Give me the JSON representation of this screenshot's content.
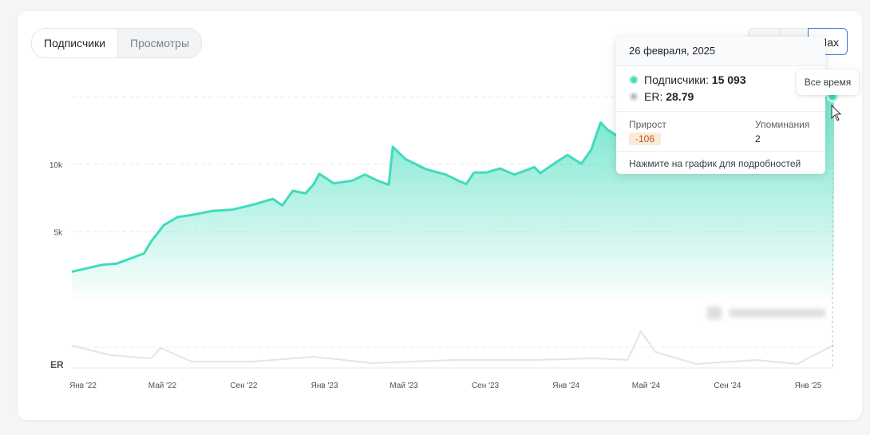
{
  "tabs": [
    {
      "label": "Подписчики",
      "active": true
    },
    {
      "label": "Просмотры",
      "active": false
    }
  ],
  "range": {
    "selected_label": "Max"
  },
  "tooltip": {
    "date": "26 февраля, 2025",
    "subscribers_label": "Подписчики:",
    "subscribers_value": "15 093",
    "er_label": "ER:",
    "er_value": "28.79",
    "growth_label": "Прирост",
    "growth_value": "-106",
    "mentions_label": "Упоминания",
    "mentions_value": "2",
    "footer": "Нажмите на график для подробностей"
  },
  "all_time_tooltip": "Все время",
  "colors": {
    "accent": "#3fdcbc",
    "er_line": "#e3e5e8",
    "selected_border": "#3a7bd5",
    "badge_bg": "#fbead9",
    "badge_text": "#c0541c"
  },
  "chart_data": {
    "type": "area",
    "series": [
      {
        "values": [
          [
            "2022-01-01",
            2050
          ],
          [
            "2022-02-15",
            2550
          ],
          [
            "2022-03-10",
            2650
          ],
          [
            "2022-04-01",
            3050
          ],
          [
            "2022-04-20",
            3400
          ],
          [
            "2022-05-01",
            4300
          ],
          [
            "2022-05-20",
            5500
          ],
          [
            "2022-06-10",
            6100
          ],
          [
            "2022-07-01",
            6250
          ],
          [
            "2022-08-01",
            6550
          ],
          [
            "2022-09-01",
            6650
          ],
          [
            "2022-10-01",
            7000
          ],
          [
            "2022-11-01",
            7450
          ],
          [
            "2022-11-15",
            6950
          ],
          [
            "2022-12-01",
            8050
          ],
          [
            "2022-12-20",
            7850
          ],
          [
            "2023-01-01",
            8500
          ],
          [
            "2023-01-10",
            9300
          ],
          [
            "2023-02-01",
            8600
          ],
          [
            "2023-03-01",
            8800
          ],
          [
            "2023-03-20",
            9250
          ],
          [
            "2023-04-10",
            8750
          ],
          [
            "2023-04-25",
            8500
          ],
          [
            "2023-05-01",
            11300
          ],
          [
            "2023-05-20",
            10400
          ],
          [
            "2023-06-20",
            9650
          ],
          [
            "2023-07-20",
            9250
          ],
          [
            "2023-08-10",
            8750
          ],
          [
            "2023-08-20",
            8550
          ],
          [
            "2023-09-01",
            9400
          ],
          [
            "2023-09-20",
            9400
          ],
          [
            "2023-10-10",
            9700
          ],
          [
            "2023-11-01",
            9250
          ],
          [
            "2023-12-01",
            9800
          ],
          [
            "2023-12-10",
            9350
          ],
          [
            "2024-01-01",
            10100
          ],
          [
            "2024-01-20",
            10700
          ],
          [
            "2024-02-10",
            10050
          ],
          [
            "2024-02-25",
            11100
          ],
          [
            "2024-03-10",
            13100
          ],
          [
            "2024-03-20",
            12600
          ],
          [
            "2024-04-20",
            11600
          ],
          [
            "2025-02-26",
            15093
          ]
        ]
      }
    ],
    "er_series": {
      "label": "ER",
      "values": [
        [
          "2022-01-01",
          28
        ],
        [
          "2022-03-01",
          16
        ],
        [
          "2022-05-01",
          12
        ],
        [
          "2022-05-15",
          25
        ],
        [
          "2022-07-01",
          8
        ],
        [
          "2022-10-01",
          8
        ],
        [
          "2023-01-01",
          14
        ],
        [
          "2023-04-01",
          6
        ],
        [
          "2023-08-01",
          10
        ],
        [
          "2023-12-01",
          10
        ],
        [
          "2024-03-01",
          12
        ],
        [
          "2024-04-20",
          10
        ],
        [
          "2024-05-10",
          46
        ],
        [
          "2024-06-01",
          20
        ],
        [
          "2024-08-01",
          5
        ],
        [
          "2024-11-01",
          10
        ],
        [
          "2025-01-01",
          5
        ],
        [
          "2025-02-26",
          28.79
        ]
      ]
    },
    "x_ticks": [
      "Янв '22",
      "Май '22",
      "Сен '22",
      "Янв '23",
      "Май '23",
      "Сен '23",
      "Янв '24",
      "Май '24",
      "Сен '24",
      "Янв '25"
    ],
    "y_ticks": [
      "5k",
      "10k"
    ],
    "y_label_bottom": "ER",
    "ylim": [
      0,
      15000
    ],
    "x_range": [
      "2022-01-01",
      "2025-02-26"
    ],
    "grid": true,
    "legend": "none"
  }
}
